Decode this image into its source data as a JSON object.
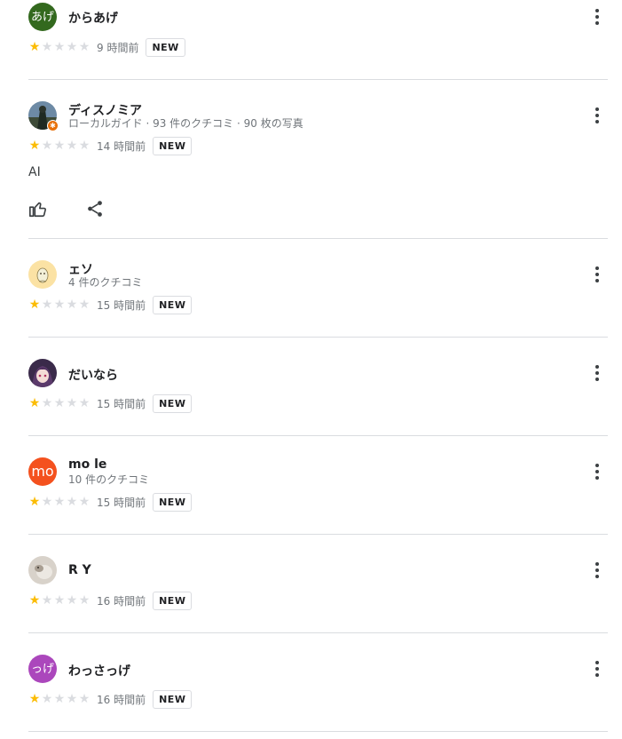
{
  "reviews": [
    {
      "name": "からあげ",
      "meta": "",
      "avatar_initials": "あげ",
      "avatar_color": "#33691e",
      "stars_filled": 1,
      "stars_total": 5,
      "time": "9 時間前",
      "badge": "NEW",
      "text": ""
    },
    {
      "name": "ディスノミア",
      "meta": "ローカルガイド · 93 件のクチコミ · 90 枚の写真",
      "avatar_initials": "",
      "avatar_color": "#4a5a6a",
      "stars_filled": 1,
      "stars_total": 5,
      "time": "14 時間前",
      "badge": "NEW",
      "text": "AI"
    },
    {
      "name": "ェソ",
      "meta": "4 件のクチコミ",
      "avatar_initials": "",
      "avatar_color": "#fbe2a4",
      "stars_filled": 1,
      "stars_total": 5,
      "time": "15 時間前",
      "badge": "NEW",
      "text": ""
    },
    {
      "name": "だいなら",
      "meta": "",
      "avatar_initials": "",
      "avatar_color": "#6b3d6e",
      "stars_filled": 1,
      "stars_total": 5,
      "time": "15 時間前",
      "badge": "NEW",
      "text": ""
    },
    {
      "name": "mo le",
      "meta": "10 件のクチコミ",
      "avatar_initials": "mo",
      "avatar_color": "#f4511e",
      "stars_filled": 1,
      "stars_total": 5,
      "time": "15 時間前",
      "badge": "NEW",
      "text": ""
    },
    {
      "name": "R Y",
      "meta": "",
      "avatar_initials": "",
      "avatar_color": "#cfc9c2",
      "stars_filled": 1,
      "stars_total": 5,
      "time": "16 時間前",
      "badge": "NEW",
      "text": ""
    },
    {
      "name": "わっさっげ",
      "meta": "",
      "avatar_initials": "っげ",
      "avatar_color": "#ab47bc",
      "stars_filled": 1,
      "stars_total": 5,
      "time": "16 時間前",
      "badge": "NEW",
      "text": ""
    }
  ],
  "icons": {
    "more": "more-vert-icon",
    "like": "thumb-up-icon",
    "share": "share-icon",
    "star": "star-icon",
    "local_guide": "local-guide-badge-icon"
  },
  "colors": {
    "star_on": "#fbbc04",
    "star_off": "#dadce0",
    "divider": "#dadce0"
  }
}
